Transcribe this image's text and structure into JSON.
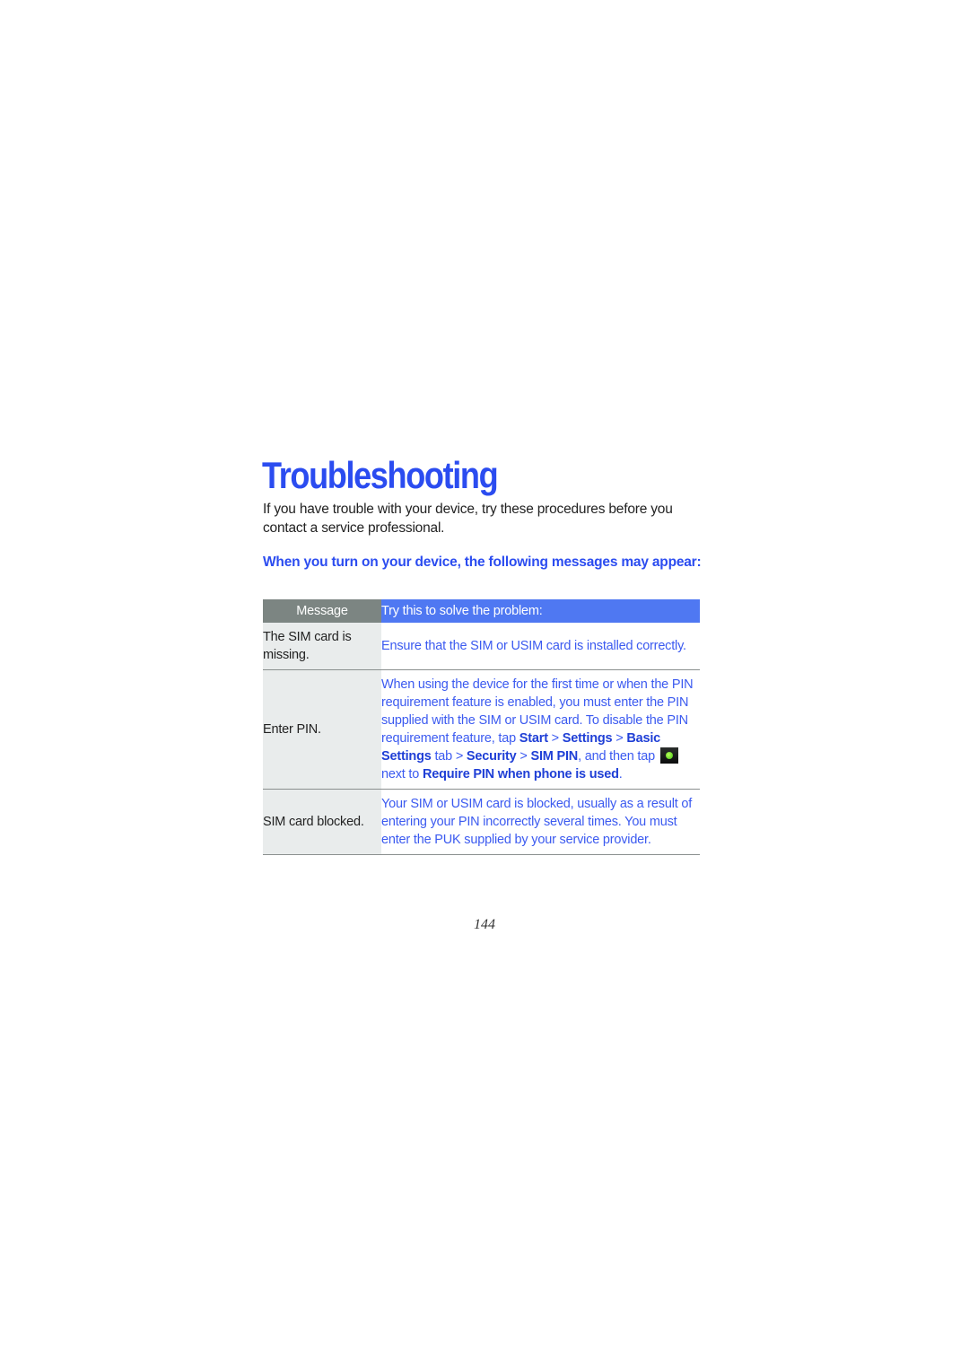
{
  "title": "Troubleshooting",
  "intro": "If you have trouble with your device, try these procedures before you contact a service professional.",
  "subheading": "When you turn on your device, the following messages may appear:",
  "table": {
    "headers": {
      "message": "Message",
      "solution": "Try this to solve the problem:"
    },
    "rows": [
      {
        "message": "The SIM card is missing.",
        "solution": "Ensure that the SIM or USIM card is installed correctly."
      },
      {
        "message": "Enter PIN.",
        "solution_parts": {
          "p1": "When using the device for the first time or when the PIN requirement feature is enabled, you must enter the PIN supplied with the SIM or USIM card. To disable the PIN requirement feature, tap ",
          "k1": "Start",
          "s1": " > ",
          "k2": "Settings",
          "s2": " > ",
          "k3": "Basic Settings",
          "s3": " tab > ",
          "k4": "Security",
          "s4": " > ",
          "k5": "SIM PIN",
          "s5": ", and then tap ",
          "icon": "green-dot-toggle-icon",
          "s6": " next to ",
          "k6": "Require PIN when phone is used",
          "s7": "."
        }
      },
      {
        "message": "SIM card blocked.",
        "solution": "Your SIM or USIM card is blocked, usually as a result of entering your PIN incorrectly several times. You must enter the PUK supplied by your service provider."
      }
    ]
  },
  "page_number": "144",
  "colors": {
    "accent": "#2b4cf0",
    "header_message_bg": "#7c8582",
    "header_solution_bg": "#4f78f2",
    "message_cell_bg": "#e9ecec"
  }
}
